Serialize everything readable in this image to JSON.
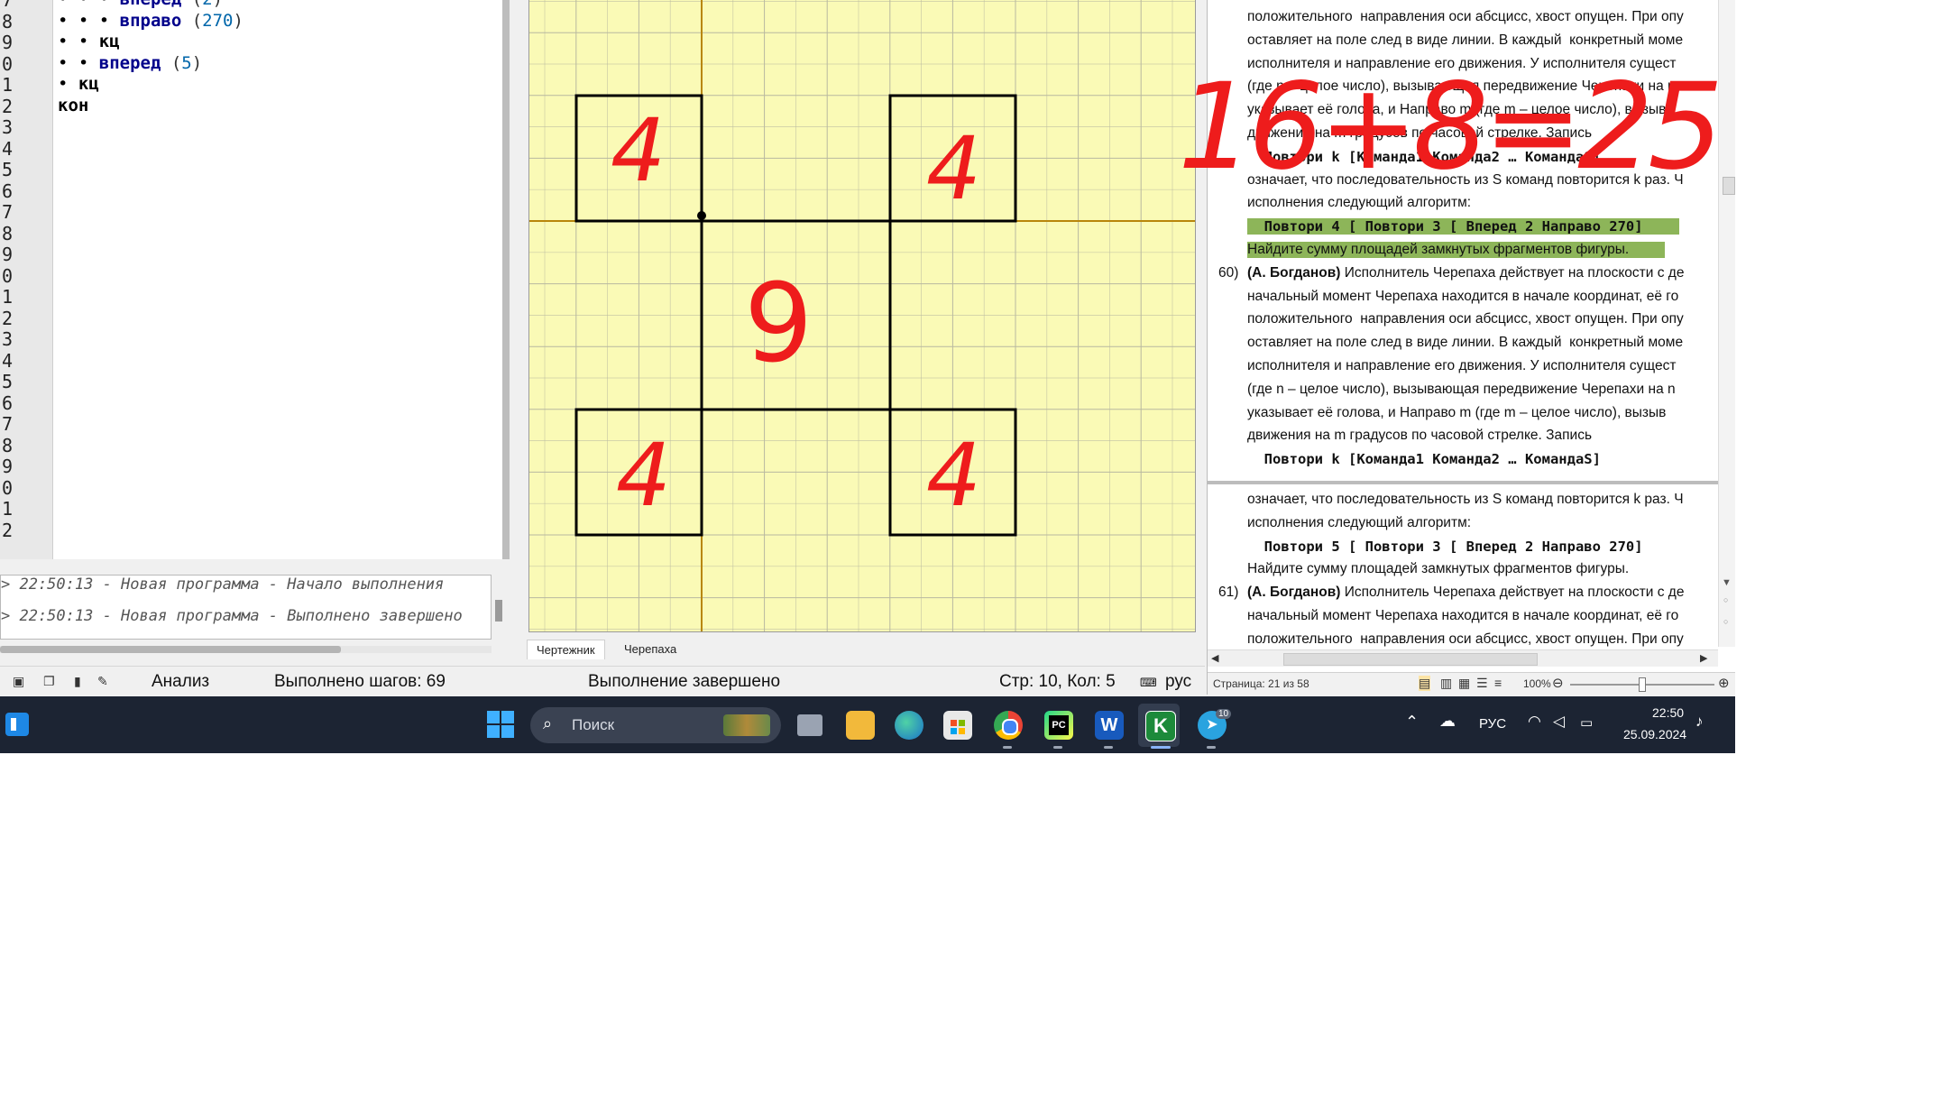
{
  "editor": {
    "line_numbers": [
      "7",
      "8",
      "9",
      "0",
      "1",
      "2",
      "3",
      "4",
      "5",
      "6",
      "7",
      "8",
      "9",
      "0",
      "1",
      "2",
      "3",
      "4",
      "5",
      "6",
      "7",
      "8",
      "9",
      "0",
      "1",
      "2"
    ],
    "lines": [
      {
        "indent": "• • • ",
        "kw": "вперед",
        "arg": "2",
        "cut": true
      },
      {
        "indent": "• • • ",
        "kw": "вправо",
        "arg": "270"
      },
      {
        "indent": "• • ",
        "kw": "кц"
      },
      {
        "indent": "• • ",
        "kw": "вперед",
        "arg": "5"
      },
      {
        "indent": "• ",
        "kw": "кц"
      },
      {
        "indent": "",
        "kw": "кон"
      }
    ]
  },
  "log": {
    "lines": [
      "> 22:50:13 - Новая программа - Начало выполнения",
      "> 22:50:13 - Новая программа - Выполнено завершено"
    ]
  },
  "statusbar": {
    "mode": "Анализ",
    "steps": "Выполнено шагов: 69",
    "state": "Выполнение завершено",
    "position": "Стр: 10, Кол: 5",
    "lang": "рус"
  },
  "canvas": {
    "tabs": [
      "Чертежник",
      "Черепаха"
    ],
    "active_tab": 0,
    "background_color": "#fafab6",
    "grid_color": "#b8b8a0",
    "axis_color": "#b8860b",
    "annotation_color": "#ee1c1c",
    "annotations": {
      "top_left": "4",
      "top_right": "4",
      "center": "9",
      "bottom_left": "4",
      "bottom_right": "4"
    }
  },
  "document": {
    "page_a": [
      {
        "num": "",
        "text": "положительного  направления оси абсцисс, хвост опущен. При опу"
      },
      {
        "num": "",
        "text": "оставляет на поле след в виде линии. В каждый  конкретный моме"
      },
      {
        "num": "",
        "text": "исполнителя и направление его движения. У исполнителя сущест"
      },
      {
        "num": "",
        "text": "(где n – целое число), вызывающая передвижение Черепахи на n"
      },
      {
        "num": "",
        "text": "указывает её голова, и Направо m (где m – целое число), вызыв"
      },
      {
        "num": "",
        "text": "движения на m градусов по часовой стрелке. Запись"
      },
      {
        "num": "",
        "mono": true,
        "text": "  Повтори k [Команда1 Команда2 … КомандаS]"
      },
      {
        "num": "",
        "text": "означает, что последовательность из S команд повторится k раз. Ч"
      },
      {
        "num": "",
        "text": "исполнения следующий алгоритм:"
      },
      {
        "num": "",
        "mono": true,
        "hl": true,
        "text": "  Повтори 4 [ Повтори 3 [ Вперед 2 Направо 270]"
      },
      {
        "num": "",
        "hl": true,
        "text": "Найдите сумму площадей замкнутых фрагментов фигуры."
      },
      {
        "num": "60)",
        "author": "(А. Богданов)",
        "text": " Исполнитель Черепаха действует на плоскости с де"
      },
      {
        "num": "",
        "text": "начальный момент Черепаха находится в начале координат, её го"
      },
      {
        "num": "",
        "text": "положительного  направления оси абсцисс, хвост опущен. При опу"
      },
      {
        "num": "",
        "text": "оставляет на поле след в виде линии. В каждый  конкретный моме"
      },
      {
        "num": "",
        "text": "исполнителя и направление его движения. У исполнителя сущест"
      },
      {
        "num": "",
        "text": "(где n – целое число), вызывающая передвижение Черепахи на n"
      },
      {
        "num": "",
        "text": "указывает её голова, и Направо m (где m – целое число), вызыв"
      },
      {
        "num": "",
        "text": "движения на m градусов по часовой стрелке. Запись"
      },
      {
        "num": "",
        "mono": true,
        "text": "  Повтори k [Команда1 Команда2 … КомандаS]"
      }
    ],
    "page_b": [
      {
        "num": "",
        "text": "означает, что последовательность из S команд повторится k раз. Ч"
      },
      {
        "num": "",
        "text": "исполнения следующий алгоритм:"
      },
      {
        "num": "",
        "mono": true,
        "text": "  Повтори 5 [ Повтори 3 [ Вперед 2 Направо 270]"
      },
      {
        "num": "",
        "text": "Найдите сумму площадей замкнутых фрагментов фигуры."
      },
      {
        "num": "61)",
        "author": "(А. Богданов)",
        "text": " Исполнитель Черепаха действует на плоскости с де"
      },
      {
        "num": "",
        "text": "начальный момент Черепаха находится в начале координат, её го"
      },
      {
        "num": "",
        "text": "положительного  направления оси абсцисс, хвост опущен. При опу"
      }
    ],
    "status": {
      "page": "Страница: 21 из 58",
      "zoom": "100%"
    },
    "highlight_color": "#8db559"
  },
  "handwritten_overlay": {
    "text": "16+8=25",
    "color": "#ee1c1c"
  },
  "taskbar": {
    "search_placeholder": "Поиск",
    "apps": [
      "windows-start",
      "task-view",
      "file-explorer",
      "edge",
      "microsoft-store",
      "chrome",
      "pycharm",
      "word",
      "kumir",
      "telegram"
    ],
    "telegram_badge": "10",
    "lang": "РУС",
    "time": "22:50",
    "date": "25.09.2024"
  }
}
